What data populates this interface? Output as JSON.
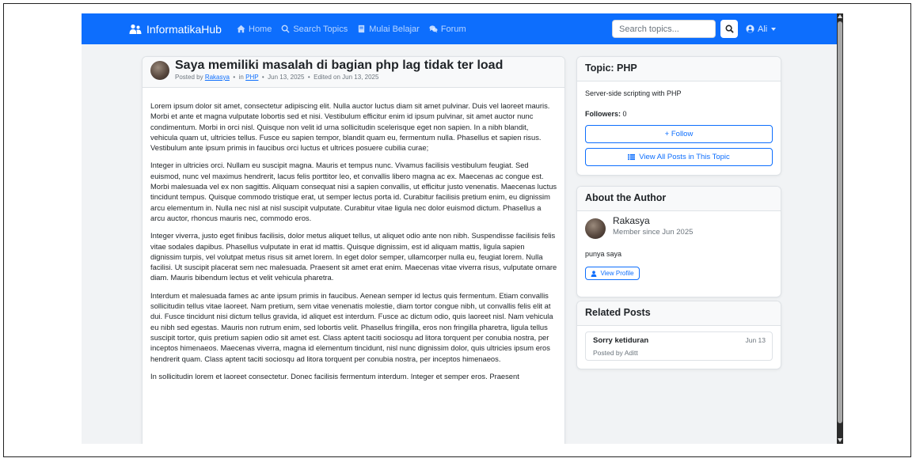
{
  "navbar": {
    "brand": "InformatikaHub",
    "links": [
      {
        "label": "Home",
        "icon": "home-icon"
      },
      {
        "label": "Search Topics",
        "icon": "search-icon"
      },
      {
        "label": "Mulai Belajar",
        "icon": "book-icon"
      },
      {
        "label": "Forum",
        "icon": "comments-icon"
      }
    ],
    "search_placeholder": "Search topics...",
    "user": "Ali",
    "accent_color": "#0d6efd"
  },
  "post": {
    "title": "Saya memiliki masalah di bagian php lag tidak ter load",
    "posted_by_prefix": "Posted by",
    "author": "Rakasya",
    "in_prefix": "in",
    "topic": "PHP",
    "date": "Jun 13, 2025",
    "edited": "Edited on Jun 13, 2025",
    "separator": "•",
    "paragraphs": [
      "Lorem ipsum dolor sit amet, consectetur adipiscing elit. Nulla auctor luctus diam sit amet pulvinar. Duis vel laoreet mauris. Morbi et ante et magna vulputate lobortis sed et nisi. Vestibulum efficitur enim id ipsum pulvinar, sit amet auctor nunc condimentum. Morbi in orci nisl. Quisque non velit id urna sollicitudin scelerisque eget non sapien. In a nibh blandit, vehicula quam ut, ultricies tellus. Fusce eu sapien tempor, blandit quam eu, fermentum nulla. Phasellus et sapien risus. Vestibulum ante ipsum primis in faucibus orci luctus et ultrices posuere cubilia curae;",
      "Integer in ultricies orci. Nullam eu suscipit magna. Mauris et tempus nunc. Vivamus facilisis vestibulum feugiat. Sed euismod, nunc vel maximus hendrerit, lacus felis porttitor leo, et convallis libero magna ac ex. Maecenas ac congue est. Morbi malesuada vel ex non sagittis. Aliquam consequat nisi a sapien convallis, ut efficitur justo venenatis. Maecenas luctus tincidunt tempus. Quisque commodo tristique erat, ut semper lectus porta id. Curabitur facilisis pretium enim, eu dignissim arcu elementum in. Nulla nec nisl at nisl suscipit vulputate. Curabitur vitae ligula nec dolor euismod dictum. Phasellus a arcu auctor, rhoncus mauris nec, commodo eros.",
      "Integer viverra, justo eget finibus facilisis, dolor metus aliquet tellus, ut aliquet odio ante non nibh. Suspendisse facilisis felis vitae sodales dapibus. Phasellus vulputate in erat id mattis. Quisque dignissim, est id aliquam mattis, ligula sapien dignissim turpis, vel volutpat metus risus sit amet lorem. In eget dolor semper, ullamcorper nulla eu, feugiat lorem. Nulla facilisi. Ut suscipit placerat sem nec malesuada. Praesent sit amet erat enim. Maecenas vitae viverra risus, vulputate ornare diam. Mauris bibendum lectus et velit vehicula pharetra.",
      "Interdum et malesuada fames ac ante ipsum primis in faucibus. Aenean semper id lectus quis fermentum. Etiam convallis sollicitudin tellus vitae laoreet. Nam pretium, sem vitae venenatis molestie, diam tortor congue nibh, ut convallis felis elit at dui. Fusce tincidunt nisi dictum tellus gravida, id aliquet est interdum. Fusce ac dictum odio, quis laoreet nisl. Nam vehicula eu nibh sed egestas. Mauris non rutrum enim, sed lobortis velit. Phasellus fringilla, eros non fringilla pharetra, ligula tellus suscipit tortor, quis pretium sapien odio sit amet est. Class aptent taciti sociosqu ad litora torquent per conubia nostra, per inceptos himenaeos. Maecenas viverra, magna id elementum tincidunt, nisl nunc dignissim dolor, quis ultricies ipsum eros hendrerit quam. Class aptent taciti sociosqu ad litora torquent per conubia nostra, per inceptos himenaeos.",
      "In sollicitudin lorem et laoreet consectetur. Donec facilisis fermentum interdum. Integer et semper eros. Praesent"
    ]
  },
  "topic_card": {
    "title": "Topic: PHP",
    "description": "Server-side scripting with PHP",
    "followers_label": "Followers:",
    "followers_count": "0",
    "follow_button": "+ Follow",
    "view_all_button": "View All Posts in This Topic"
  },
  "author_card": {
    "title": "About the Author",
    "name": "Rakasya",
    "member_since": "Member since Jun 2025",
    "bio": "punya saya",
    "view_profile_button": "View Profile"
  },
  "related_card": {
    "title": "Related Posts",
    "items": [
      {
        "title": "Sorry ketiduran",
        "date": "Jun 13",
        "posted_by": "Posted by Aditt"
      }
    ]
  }
}
